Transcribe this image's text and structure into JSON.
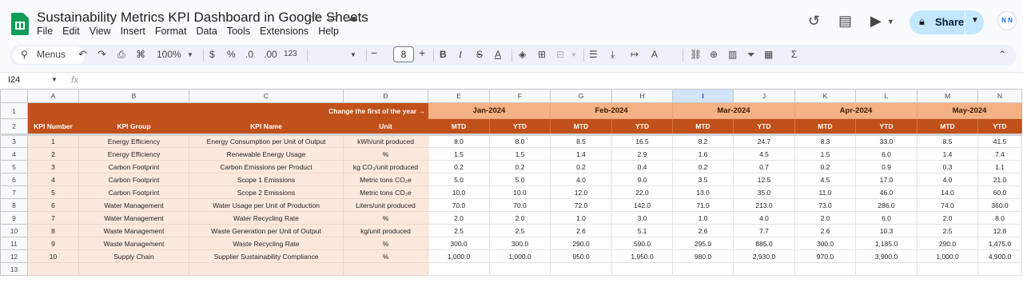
{
  "app": {
    "title": "Sustainability Metrics KPI Dashboard in Google Sheets",
    "menu": [
      "File",
      "Edit",
      "View",
      "Insert",
      "Format",
      "Data",
      "Tools",
      "Extensions",
      "Help"
    ],
    "share_label": "Share",
    "avatar_text": "N N"
  },
  "toolbar": {
    "search_label": "Menus",
    "zoom": "100%",
    "currency": "$",
    "percent": "%",
    "dec_decrease": ".0",
    "dec_increase": ".00",
    "number_format": "123",
    "font_size": "8"
  },
  "formula_bar": {
    "cell_ref": "I24",
    "fx": "fx"
  },
  "sheet": {
    "columns": [
      "A",
      "B",
      "C",
      "D",
      "E",
      "F",
      "G",
      "H",
      "I",
      "J",
      "K",
      "L",
      "M",
      "N"
    ],
    "selected_column": "I",
    "banner": "Change the first of the year →",
    "months": [
      "Jan-2024",
      "Feb-2024",
      "Mar-2024",
      "Apr-2024",
      "May-2024"
    ],
    "headers": [
      "KPI Number",
      "KPI Group",
      "KPI Name",
      "Unit"
    ],
    "sub_headers": [
      "MTD",
      "YTD"
    ],
    "rows": [
      {
        "n": "1",
        "group": "Energy Efficiency",
        "name": "Energy Consumption per Unit of Output",
        "unit": "kWh/unit produced",
        "vals": [
          "8.0",
          "8.0",
          "8.5",
          "16.5",
          "8.2",
          "24.7",
          "8.3",
          "33.0",
          "8.5",
          "41.5"
        ]
      },
      {
        "n": "2",
        "group": "Energy Efficiency",
        "name": "Renewable Energy Usage",
        "unit": "%",
        "vals": [
          "1.5",
          "1.5",
          "1.4",
          "2.9",
          "1.6",
          "4.5",
          "1.5",
          "6.0",
          "1.4",
          "7.4"
        ]
      },
      {
        "n": "3",
        "group": "Carbon Footprint",
        "name": "Carbon Emissions per Product",
        "unit": "kg CO₂/unit produced",
        "vals": [
          "0.2",
          "0.2",
          "0.2",
          "0.4",
          "0.2",
          "0.7",
          "0.2",
          "0.9",
          "0.3",
          "1.1"
        ]
      },
      {
        "n": "4",
        "group": "Carbon Footprint",
        "name": "Scope 1 Emissions",
        "unit": "Metric tons CO₂e",
        "vals": [
          "5.0",
          "5.0",
          "4.0",
          "9.0",
          "3.5",
          "12.5",
          "4.5",
          "17.0",
          "4.0",
          "21.0"
        ]
      },
      {
        "n": "5",
        "group": "Carbon Footprint",
        "name": "Scope 2 Emissions",
        "unit": "Metric tons CO₂e",
        "vals": [
          "10.0",
          "10.0",
          "12.0",
          "22.0",
          "13.0",
          "35.0",
          "11.0",
          "46.0",
          "14.0",
          "60.0"
        ]
      },
      {
        "n": "6",
        "group": "Water Management",
        "name": "Water Usage per Unit of Production",
        "unit": "Liters/unit produced",
        "vals": [
          "70.0",
          "70.0",
          "72.0",
          "142.0",
          "71.0",
          "213.0",
          "73.0",
          "286.0",
          "74.0",
          "360.0"
        ]
      },
      {
        "n": "7",
        "group": "Water Management",
        "name": "Water Recycling Rate",
        "unit": "%",
        "vals": [
          "2.0",
          "2.0",
          "1.0",
          "3.0",
          "1.0",
          "4.0",
          "2.0",
          "6.0",
          "2.0",
          "8.0"
        ]
      },
      {
        "n": "8",
        "group": "Waste Management",
        "name": "Waste Generation per Unit of Output",
        "unit": "kg/unit produced",
        "vals": [
          "2.5",
          "2.5",
          "2.6",
          "5.1",
          "2.6",
          "7.7",
          "2.6",
          "10.3",
          "2.5",
          "12.8"
        ]
      },
      {
        "n": "9",
        "group": "Waste Management",
        "name": "Waste Recycling Rate",
        "unit": "%",
        "vals": [
          "300.0",
          "300.0",
          "290.0",
          "590.0",
          "295.0",
          "885.0",
          "300.0",
          "1,185.0",
          "290.0",
          "1,475.0"
        ]
      },
      {
        "n": "10",
        "group": "Supply Chain",
        "name": "Supplier Sustainability Compliance",
        "unit": "%",
        "vals": [
          "1,000.0",
          "1,000.0",
          "950.0",
          "1,950.0",
          "980.0",
          "2,930.0",
          "970.0",
          "3,900.0",
          "1,000.0",
          "4,900.0"
        ]
      }
    ],
    "row_numbers": [
      "1",
      "2",
      "3",
      "4",
      "5",
      "6",
      "7",
      "8",
      "9",
      "10",
      "11",
      "12",
      "13"
    ]
  }
}
